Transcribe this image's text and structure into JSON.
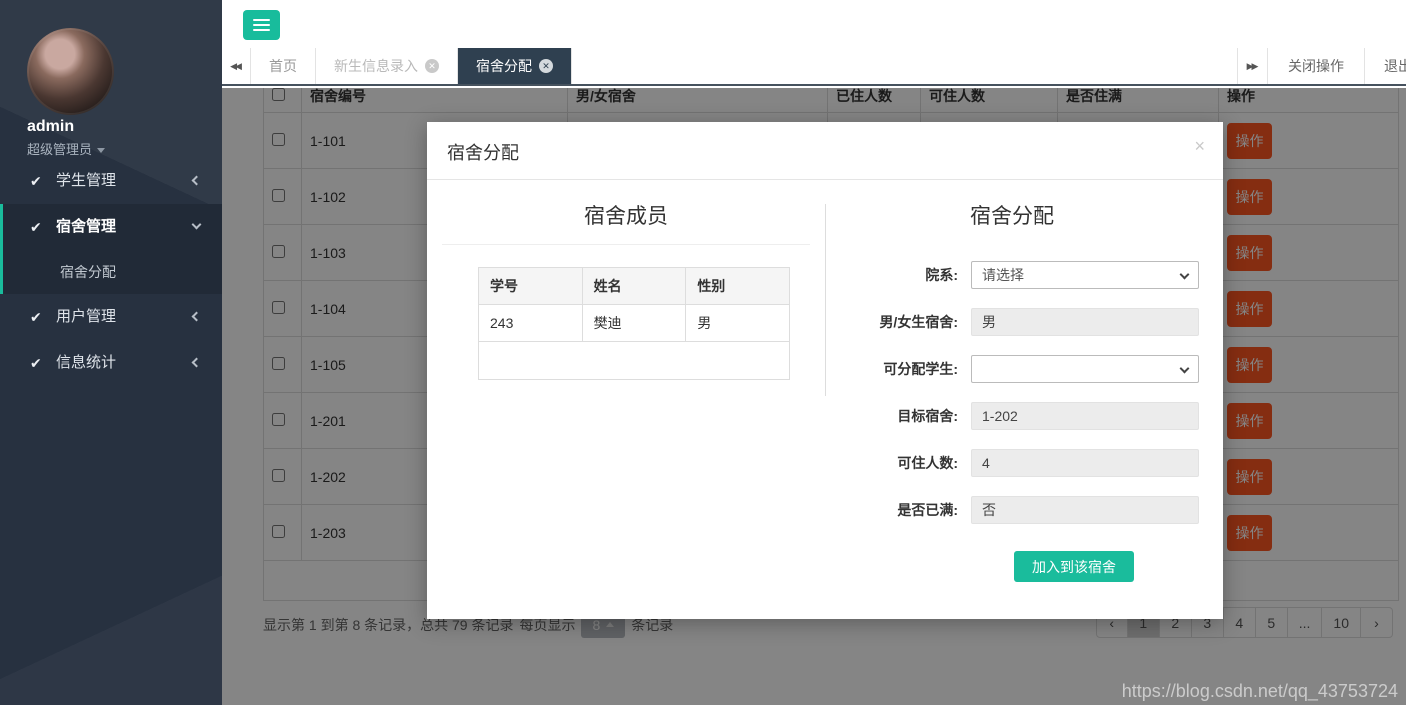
{
  "sidebar": {
    "user": {
      "name": "admin",
      "role": "超级管理员"
    },
    "menu": [
      {
        "label": "学生管理",
        "state": "collapsed",
        "active": false
      },
      {
        "label": "宿舍管理",
        "state": "expanded",
        "active": true,
        "children": [
          {
            "label": "宿舍分配"
          }
        ]
      },
      {
        "label": "用户管理",
        "state": "collapsed",
        "active": false
      },
      {
        "label": "信息统计",
        "state": "collapsed",
        "active": false
      }
    ]
  },
  "tabbar": {
    "tabs": [
      {
        "label": "首页",
        "closable": false,
        "active": false
      },
      {
        "label": "新生信息录入",
        "closable": true,
        "active": false
      },
      {
        "label": "宿舍分配",
        "closable": true,
        "active": true
      }
    ],
    "close_ops_label": "关闭操作",
    "logout_label": "退出"
  },
  "table": {
    "headers": [
      "宿舍编号",
      "男/女宿舍",
      "已住人数",
      "可住人数",
      "是否住满",
      "操作"
    ],
    "action_label": "操作",
    "rows": [
      {
        "room": "1-101"
      },
      {
        "room": "1-102"
      },
      {
        "room": "1-103"
      },
      {
        "room": "1-104"
      },
      {
        "room": "1-105"
      },
      {
        "room": "1-201"
      },
      {
        "room": "1-202"
      },
      {
        "room": "1-203"
      }
    ]
  },
  "pagination": {
    "summary_prefix": "显示第 1 到第 8 条记录，总共 79 条记录",
    "per_page_label": "每页显示",
    "page_size": "8",
    "summary_suffix": "条记录",
    "prev_icon": "‹",
    "next_icon": "›",
    "pages": [
      "1",
      "2",
      "3",
      "4",
      "5",
      "...",
      "10"
    ],
    "active_page": "1"
  },
  "modal": {
    "title": "宿舍分配",
    "close_icon": "×",
    "members": {
      "heading": "宿舍成员",
      "headers": [
        "学号",
        "姓名",
        "性别"
      ],
      "rows": [
        [
          "243",
          "樊迪",
          "男"
        ]
      ]
    },
    "assign": {
      "heading": "宿舍分配",
      "fields": [
        {
          "label": "院系:",
          "type": "select",
          "value": "请选择"
        },
        {
          "label": "男/女生宿舍:",
          "type": "readonly",
          "value": "男"
        },
        {
          "label": "可分配学生:",
          "type": "select",
          "value": ""
        },
        {
          "label": "目标宿舍:",
          "type": "readonly",
          "value": "1-202"
        },
        {
          "label": "可住人数:",
          "type": "readonly",
          "value": "4"
        },
        {
          "label": "是否已满:",
          "type": "readonly",
          "value": "否"
        }
      ],
      "submit_label": "加入到该宿舍"
    }
  },
  "watermark": "https://blog.csdn.net/qq_43753724",
  "colors": {
    "accent_teal": "#1abc9c",
    "sidebar_bg": "#273140",
    "active_tab_bg": "#2f4050",
    "action_button": "#ff5722",
    "overlay": "rgba(0,0,0,0.48)"
  }
}
